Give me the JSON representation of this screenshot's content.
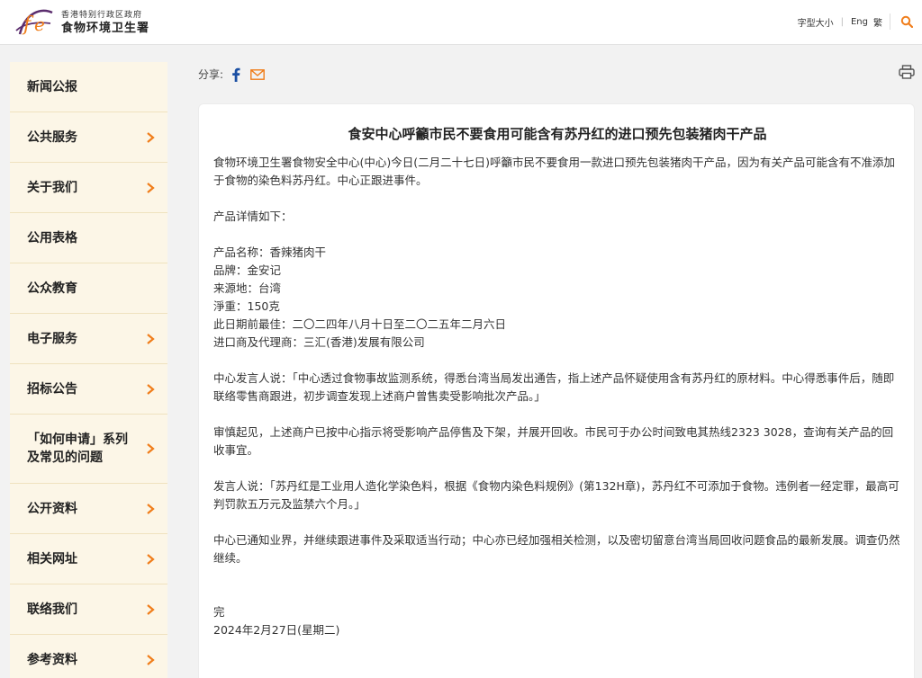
{
  "header": {
    "org_line1": "香港特别行政区政府",
    "org_line2": "食物环境卫生署",
    "font_size_label": "字型大小",
    "lang_eng": "Eng",
    "lang_trad": "繁",
    "search_icon": "search-icon"
  },
  "colors": {
    "accent": "#f07d1a",
    "sidebar_bg": "#fcf6e7",
    "facebook": "#1a4fa3",
    "logo_purple": "#5b2d6e"
  },
  "sidebar": {
    "items": [
      {
        "label": "新闻公报"
      },
      {
        "label": "公共服务"
      },
      {
        "label": "关于我们"
      },
      {
        "label": "公用表格"
      },
      {
        "label": "公众教育"
      },
      {
        "label": "电子服务"
      },
      {
        "label": "招标公告"
      },
      {
        "label": "「如何申请」系列及常见的问题"
      },
      {
        "label": "公开资料"
      },
      {
        "label": "相关网址"
      },
      {
        "label": "联络我们"
      },
      {
        "label": "参考资料"
      }
    ]
  },
  "share": {
    "label": "分享:"
  },
  "article": {
    "title": "食安中心呼籲市民不要食用可能含有苏丹红的进口预先包装猪肉干产品",
    "para1": "食物环境卫生署食物安全中心(中心)今日(二月二十七日)呼籲市民不要食用一款进口预先包装猪肉干产品，因为有关产品可能含有不准添加于食物的染色料苏丹红。中心正跟进事件。",
    "details_intro": "产品详情如下：",
    "details": [
      "产品名称：香辣猪肉干",
      "品牌：金安记",
      "来源地：台湾",
      "淨重：150克",
      "此日期前最佳：二〇二四年八月十日至二〇二五年二月六日",
      "进口商及代理商：三汇(香港)发展有限公司"
    ],
    "para2": "中心发言人说：「中心透过食物事故监测系统，得悉台湾当局发出通告，指上述产品怀疑使用含有苏丹红的原材料。中心得悉事件后，随即联络零售商跟进，初步调查发现上述商户曾售卖受影响批次产品。」",
    "para3": "审慎起见，上述商户已按中心指示将受影响产品停售及下架，并展开回收。市民可于办公时间致电其热线2323 3028，查询有关产品的回收事宜。",
    "para4": "发言人说：「苏丹红是工业用人造化学染色料，根据《食物内染色料规例》(第132H章)，苏丹红不可添加于食物。违例者一经定罪，最高可判罚款五万元及监禁六个月。」",
    "para5": "中心已通知业界，并继续跟进事件及采取适当行动；中心亦已经加强相关检测，以及密切留意台湾当局回收问题食品的最新发展。调查仍然继续。",
    "end": "完",
    "date": "2024年2月27日(星期二)"
  }
}
